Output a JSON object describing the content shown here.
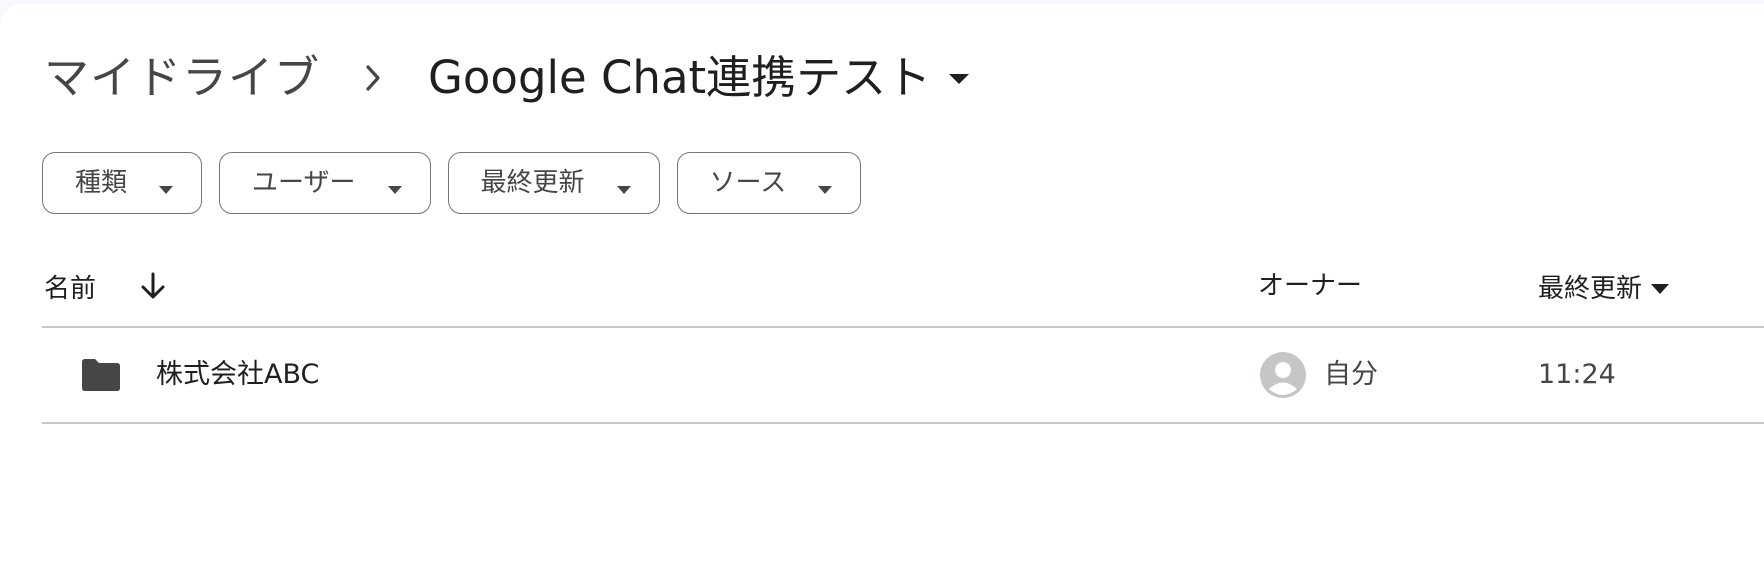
{
  "breadcrumb": {
    "root_label": "マイドライブ",
    "separator_icon": "chevron-right-icon",
    "current_label": "Google Chat連携テスト",
    "current_dropdown_icon": "caret-down-icon"
  },
  "filters": [
    {
      "label": "種類"
    },
    {
      "label": "ユーザー"
    },
    {
      "label": "最終更新"
    },
    {
      "label": "ソース"
    }
  ],
  "table": {
    "columns": {
      "name": "名前",
      "name_sort_icon": "arrow-down-icon",
      "owner": "オーナー",
      "modified": "最終更新",
      "modified_sort_icon": "caret-down-icon"
    },
    "rows": [
      {
        "icon": "folder-icon",
        "name": "株式会社ABC",
        "owner_avatar_icon": "default-avatar-icon",
        "owner": "自分",
        "modified": "11:24"
      }
    ]
  },
  "colors": {
    "text_primary": "#1f1f1f",
    "text_secondary": "#444746",
    "chip_border": "#747775",
    "divider": "#c7c7c7",
    "folder": "#444746",
    "avatar_bg": "#c4c7c5"
  }
}
